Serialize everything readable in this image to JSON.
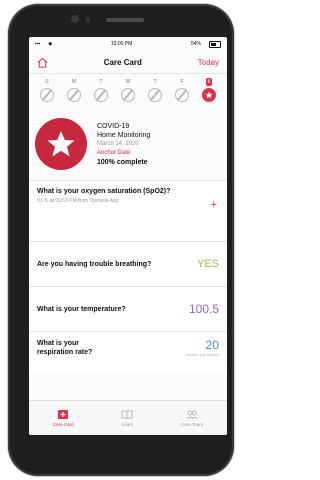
{
  "status_bar": {
    "time": "10:00 PM",
    "battery": "54%"
  },
  "nav": {
    "title": "Care Card",
    "today_label": "Today"
  },
  "week": {
    "days": [
      "S",
      "M",
      "T",
      "W",
      "T",
      "F",
      "S"
    ],
    "active_index": 6,
    "active_marker": "6"
  },
  "header": {
    "title": "COVID-19",
    "subtitle": "Home Monitoring",
    "date": "March 14, 2020",
    "anchor_label": "Anchor Date",
    "progress_text": "100% complete",
    "icon": "star-icon"
  },
  "cards": {
    "oxygen": {
      "question": "What is your oxygen saturation (SpO2)?",
      "detail": "91 % at 09:59 PM from Docilella App",
      "action": "+"
    },
    "breathing": {
      "question": "Are you having trouble breathing?",
      "answer": "YES"
    },
    "temperature": {
      "question": "What is your temperature?",
      "value": "100.5"
    },
    "respiration": {
      "question": "What is your respiration rate?",
      "value": "20",
      "unit": "breaths per minute"
    }
  },
  "tabs": [
    {
      "label": "Care Card",
      "icon": "care-card-icon",
      "active": true
    },
    {
      "label": "Learn",
      "icon": "book-icon",
      "active": false
    },
    {
      "label": "Care Team",
      "icon": "team-icon",
      "active": false
    }
  ],
  "colors": {
    "accent": "#e0304c",
    "badge": "#c8283f",
    "yes": "#8cc63f",
    "temp": "#8e6bb5",
    "resp": "#4a90d9"
  }
}
